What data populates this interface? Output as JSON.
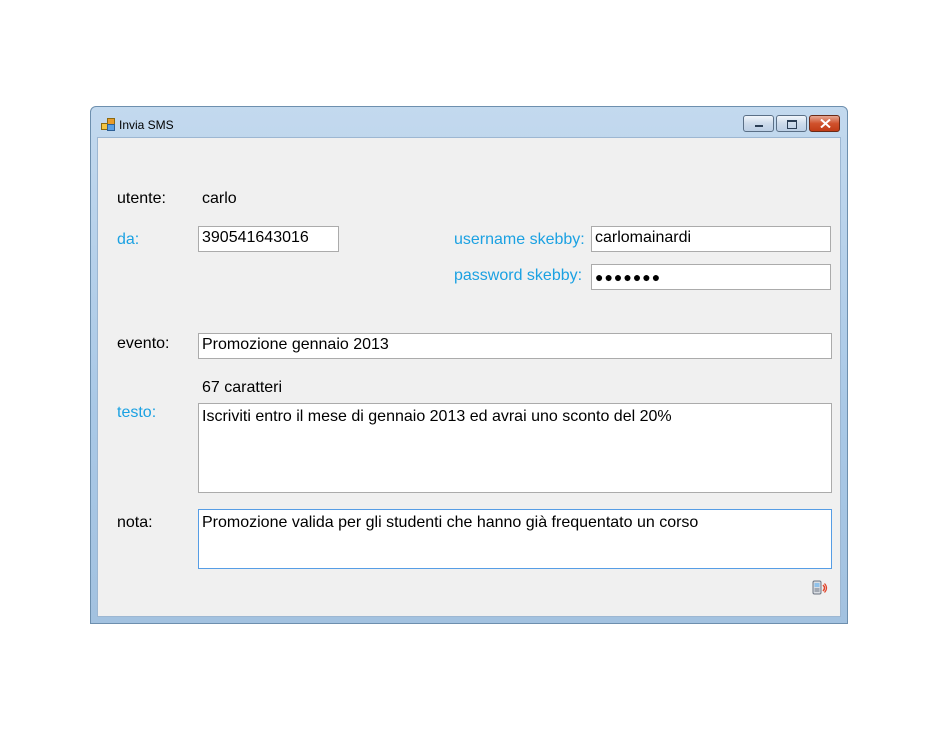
{
  "window": {
    "title": "Invia SMS",
    "app_icon": "windows-form-icon",
    "controls": {
      "minimize_icon": "minimize-icon",
      "maximize_icon": "maximize-icon",
      "close_icon": "close-icon"
    }
  },
  "form": {
    "utente_label": "utente:",
    "utente_value": "carlo",
    "da_label": "da:",
    "da_value": "390541643016",
    "username_label": "username skebby:",
    "username_value": "carlomainardi",
    "password_label": "password skebby:",
    "password_value": "●●●●●●●",
    "evento_label": "evento:",
    "evento_value": "Promozione gennaio 2013",
    "char_count": "67 caratteri",
    "testo_label": "testo:",
    "testo_value": "Iscriviti entro il mese di gennaio 2013 ed avrai uno sconto del 20%",
    "nota_label": "nota:",
    "nota_value": "Promozione valida per gli studenti che hanno già frequentato un corso",
    "send_icon": "send-sms-icon"
  },
  "colors": {
    "link_label": "#1ba1e2",
    "client_bg": "#f0f0f0",
    "close_button": "#c8441d"
  }
}
